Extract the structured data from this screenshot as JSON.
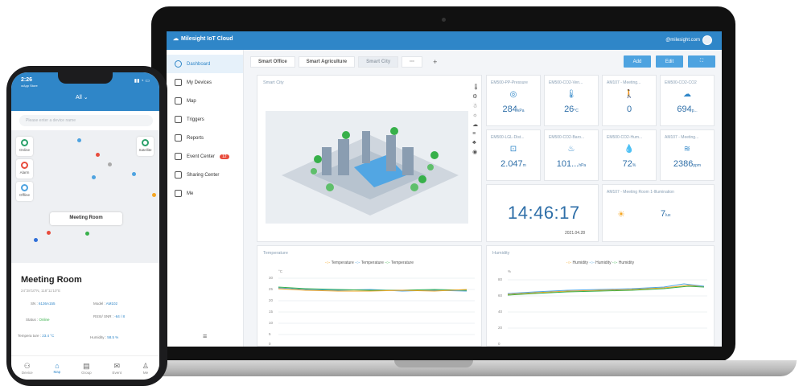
{
  "app": {
    "title": "Milesight IoT Cloud",
    "user": "@milesight.com"
  },
  "sidebar": {
    "items": [
      {
        "label": "Dashboard",
        "icon": "dashboard-icon"
      },
      {
        "label": "My Devices",
        "icon": "devices-icon"
      },
      {
        "label": "Map",
        "icon": "map-icon"
      },
      {
        "label": "Triggers",
        "icon": "triggers-icon"
      },
      {
        "label": "Reports",
        "icon": "reports-icon"
      },
      {
        "label": "Event Center",
        "icon": "event-icon",
        "badge": "12"
      },
      {
        "label": "Sharing Center",
        "icon": "share-icon"
      },
      {
        "label": "Me",
        "icon": "user-icon"
      }
    ],
    "collapse": "≡"
  },
  "tabs": [
    {
      "label": "Smart Office"
    },
    {
      "label": "Smart Agriculture"
    },
    {
      "label": "Smart City"
    },
    {
      "label": "···"
    },
    {
      "label": "+"
    }
  ],
  "buttons": {
    "add": "Add",
    "edit": "Edit",
    "full": "⛶"
  },
  "map_card": {
    "title": "Smart City"
  },
  "tiles": [
    {
      "title": "EM500-PP-Pressure",
      "icon": "◎",
      "value": "284",
      "unit": "kPa"
    },
    {
      "title": "EM500-CO2-Ven...",
      "icon": "🌡",
      "value": "26",
      "unit": "°C"
    },
    {
      "title": "AM107 - Meeting...",
      "icon": "🚶",
      "value": "0",
      "unit": ""
    },
    {
      "title": "EM500-CO2-CO2",
      "icon": "☁",
      "value": "694",
      "unit": "p..."
    },
    {
      "title": "EM500-LGL-Dist...",
      "icon": "⊡",
      "value": "2.047",
      "unit": "m"
    },
    {
      "title": "EM500-CO2-Baro...",
      "icon": "♨",
      "value": "101...",
      "unit": "hPa"
    },
    {
      "title": "EM500-CO2-Hum...",
      "icon": "💧",
      "value": "72",
      "unit": "%"
    },
    {
      "title": "AM107 - Meeting...",
      "icon": "≋",
      "value": "2386",
      "unit": "ppm"
    }
  ],
  "clock": {
    "time": "14:46:17",
    "date": "2021.04.28"
  },
  "illum": {
    "title": "AM107 - Meeting Room 1-Illumination",
    "icon": "☀",
    "value": "7",
    "unit": "lux"
  },
  "temp_chart": {
    "title": "Temperature",
    "legend": [
      "Temperature",
      "Temperature",
      "Temperature"
    ],
    "ylabel": "°C",
    "ticks": [
      "30",
      "25",
      "20",
      "15",
      "10",
      "5",
      "0"
    ]
  },
  "hum_chart": {
    "title": "Humidity",
    "legend": [
      "Humidity",
      "Humidity",
      "Humidity"
    ],
    "ylabel": "%",
    "ticks": [
      "80",
      "60",
      "40",
      "20",
      "0"
    ]
  },
  "colors": {
    "primary": "#2f86c8",
    "orange": "#f5a623",
    "blue": "#4ea3e0",
    "green": "#37b04a"
  },
  "phone": {
    "time": "2:26",
    "sub": "◂ App Store",
    "filter": "All ⌄",
    "search": "Please enter a device name",
    "buttons": [
      {
        "label": "Online"
      },
      {
        "label": "Alarm"
      },
      {
        "label": "Offline"
      },
      {
        "label": "Satellite"
      }
    ],
    "tag": "Meeting Room",
    "detail": {
      "title": "Meeting Room",
      "coord": "24°28'10\"N, 118°11'10\"E",
      "rows": [
        {
          "k": "SN :",
          "v": "6136A155"
        },
        {
          "k": "Model :",
          "v": "AM102"
        },
        {
          "k": "Status :",
          "v": "Online"
        },
        {
          "k": "RSSI/ SNR :",
          "v": "-64 / 8"
        },
        {
          "k": "Tempera ture :",
          "v": "23.4 °C"
        },
        {
          "k": "Humidity :",
          "v": "58.5 %"
        }
      ]
    },
    "nav": [
      {
        "label": "Device",
        "icon": "⚇"
      },
      {
        "label": "Map",
        "icon": "⌂"
      },
      {
        "label": "Group",
        "icon": "▤"
      },
      {
        "label": "Event",
        "icon": "✉"
      },
      {
        "label": "Me",
        "icon": "♙"
      }
    ]
  }
}
